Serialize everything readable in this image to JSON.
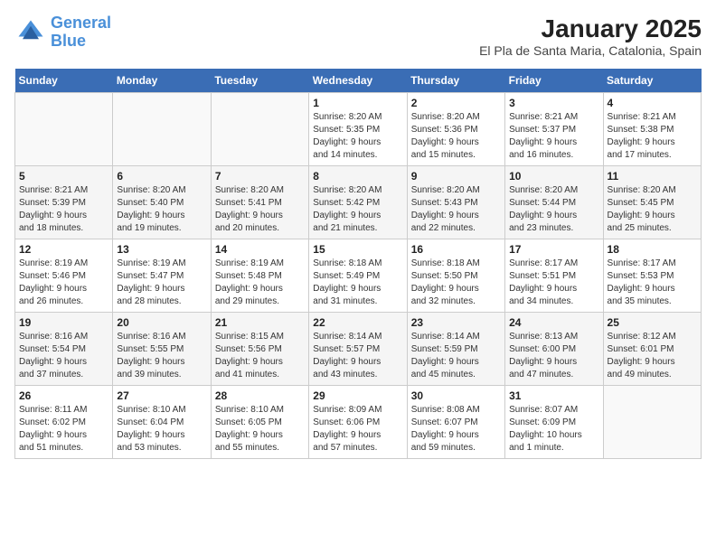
{
  "logo": {
    "line1": "General",
    "line2": "Blue"
  },
  "title": "January 2025",
  "subtitle": "El Pla de Santa Maria, Catalonia, Spain",
  "days_of_week": [
    "Sunday",
    "Monday",
    "Tuesday",
    "Wednesday",
    "Thursday",
    "Friday",
    "Saturday"
  ],
  "weeks": [
    [
      {
        "day": "",
        "info": ""
      },
      {
        "day": "",
        "info": ""
      },
      {
        "day": "",
        "info": ""
      },
      {
        "day": "1",
        "info": "Sunrise: 8:20 AM\nSunset: 5:35 PM\nDaylight: 9 hours\nand 14 minutes."
      },
      {
        "day": "2",
        "info": "Sunrise: 8:20 AM\nSunset: 5:36 PM\nDaylight: 9 hours\nand 15 minutes."
      },
      {
        "day": "3",
        "info": "Sunrise: 8:21 AM\nSunset: 5:37 PM\nDaylight: 9 hours\nand 16 minutes."
      },
      {
        "day": "4",
        "info": "Sunrise: 8:21 AM\nSunset: 5:38 PM\nDaylight: 9 hours\nand 17 minutes."
      }
    ],
    [
      {
        "day": "5",
        "info": "Sunrise: 8:21 AM\nSunset: 5:39 PM\nDaylight: 9 hours\nand 18 minutes."
      },
      {
        "day": "6",
        "info": "Sunrise: 8:20 AM\nSunset: 5:40 PM\nDaylight: 9 hours\nand 19 minutes."
      },
      {
        "day": "7",
        "info": "Sunrise: 8:20 AM\nSunset: 5:41 PM\nDaylight: 9 hours\nand 20 minutes."
      },
      {
        "day": "8",
        "info": "Sunrise: 8:20 AM\nSunset: 5:42 PM\nDaylight: 9 hours\nand 21 minutes."
      },
      {
        "day": "9",
        "info": "Sunrise: 8:20 AM\nSunset: 5:43 PM\nDaylight: 9 hours\nand 22 minutes."
      },
      {
        "day": "10",
        "info": "Sunrise: 8:20 AM\nSunset: 5:44 PM\nDaylight: 9 hours\nand 23 minutes."
      },
      {
        "day": "11",
        "info": "Sunrise: 8:20 AM\nSunset: 5:45 PM\nDaylight: 9 hours\nand 25 minutes."
      }
    ],
    [
      {
        "day": "12",
        "info": "Sunrise: 8:19 AM\nSunset: 5:46 PM\nDaylight: 9 hours\nand 26 minutes."
      },
      {
        "day": "13",
        "info": "Sunrise: 8:19 AM\nSunset: 5:47 PM\nDaylight: 9 hours\nand 28 minutes."
      },
      {
        "day": "14",
        "info": "Sunrise: 8:19 AM\nSunset: 5:48 PM\nDaylight: 9 hours\nand 29 minutes."
      },
      {
        "day": "15",
        "info": "Sunrise: 8:18 AM\nSunset: 5:49 PM\nDaylight: 9 hours\nand 31 minutes."
      },
      {
        "day": "16",
        "info": "Sunrise: 8:18 AM\nSunset: 5:50 PM\nDaylight: 9 hours\nand 32 minutes."
      },
      {
        "day": "17",
        "info": "Sunrise: 8:17 AM\nSunset: 5:51 PM\nDaylight: 9 hours\nand 34 minutes."
      },
      {
        "day": "18",
        "info": "Sunrise: 8:17 AM\nSunset: 5:53 PM\nDaylight: 9 hours\nand 35 minutes."
      }
    ],
    [
      {
        "day": "19",
        "info": "Sunrise: 8:16 AM\nSunset: 5:54 PM\nDaylight: 9 hours\nand 37 minutes."
      },
      {
        "day": "20",
        "info": "Sunrise: 8:16 AM\nSunset: 5:55 PM\nDaylight: 9 hours\nand 39 minutes."
      },
      {
        "day": "21",
        "info": "Sunrise: 8:15 AM\nSunset: 5:56 PM\nDaylight: 9 hours\nand 41 minutes."
      },
      {
        "day": "22",
        "info": "Sunrise: 8:14 AM\nSunset: 5:57 PM\nDaylight: 9 hours\nand 43 minutes."
      },
      {
        "day": "23",
        "info": "Sunrise: 8:14 AM\nSunset: 5:59 PM\nDaylight: 9 hours\nand 45 minutes."
      },
      {
        "day": "24",
        "info": "Sunrise: 8:13 AM\nSunset: 6:00 PM\nDaylight: 9 hours\nand 47 minutes."
      },
      {
        "day": "25",
        "info": "Sunrise: 8:12 AM\nSunset: 6:01 PM\nDaylight: 9 hours\nand 49 minutes."
      }
    ],
    [
      {
        "day": "26",
        "info": "Sunrise: 8:11 AM\nSunset: 6:02 PM\nDaylight: 9 hours\nand 51 minutes."
      },
      {
        "day": "27",
        "info": "Sunrise: 8:10 AM\nSunset: 6:04 PM\nDaylight: 9 hours\nand 53 minutes."
      },
      {
        "day": "28",
        "info": "Sunrise: 8:10 AM\nSunset: 6:05 PM\nDaylight: 9 hours\nand 55 minutes."
      },
      {
        "day": "29",
        "info": "Sunrise: 8:09 AM\nSunset: 6:06 PM\nDaylight: 9 hours\nand 57 minutes."
      },
      {
        "day": "30",
        "info": "Sunrise: 8:08 AM\nSunset: 6:07 PM\nDaylight: 9 hours\nand 59 minutes."
      },
      {
        "day": "31",
        "info": "Sunrise: 8:07 AM\nSunset: 6:09 PM\nDaylight: 10 hours\nand 1 minute."
      },
      {
        "day": "",
        "info": ""
      }
    ]
  ]
}
